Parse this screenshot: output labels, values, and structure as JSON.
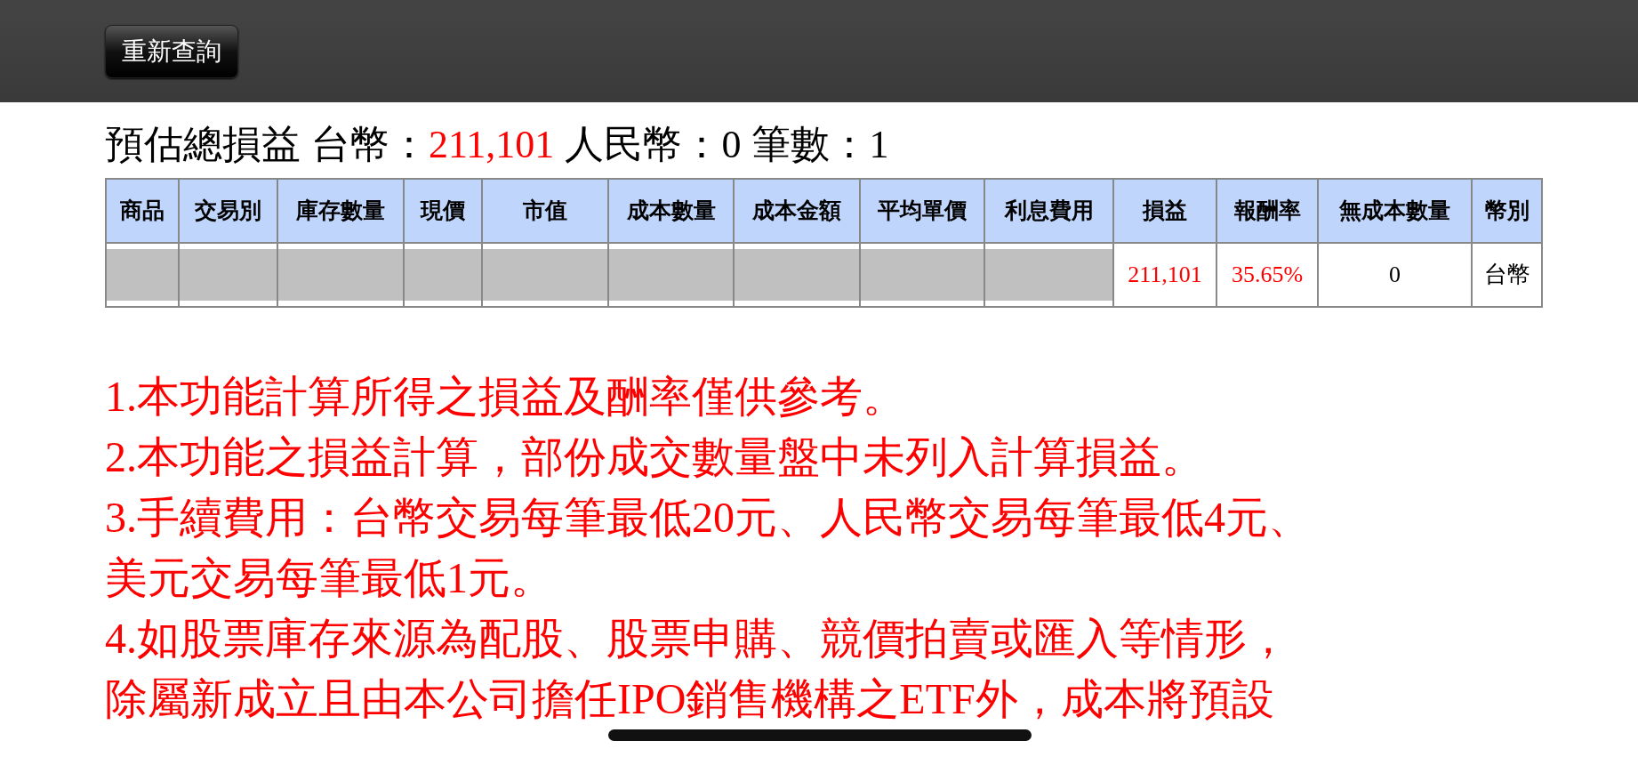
{
  "toolbar": {
    "requery_button": "重新查詢"
  },
  "summary": {
    "title": "預估總損益",
    "items": [
      {
        "label": "台幣：",
        "value": "211,101",
        "highlight": true
      },
      {
        "label": "人民幣：",
        "value": "0",
        "highlight": false
      },
      {
        "label": "筆數：",
        "value": "1",
        "highlight": false
      }
    ]
  },
  "table": {
    "columns": [
      "商品",
      "交易別",
      "庫存數量",
      "現價",
      "市值",
      "成本數量",
      "成本金額",
      "平均單價",
      "利息費用",
      "損益",
      "報酬率",
      "無成本數量",
      "幣別"
    ],
    "rows": [
      {
        "cells": [
          {
            "text": "",
            "redacted": true
          },
          {
            "text": "",
            "redacted": true
          },
          {
            "text": "",
            "redacted": true
          },
          {
            "text": "",
            "redacted": true
          },
          {
            "text": "",
            "redacted": true
          },
          {
            "text": "",
            "redacted": true
          },
          {
            "text": "",
            "redacted": true
          },
          {
            "text": "",
            "redacted": true
          },
          {
            "text": "",
            "redacted": true
          },
          {
            "text": "211,101",
            "highlight": true
          },
          {
            "text": "35.65%",
            "highlight": true
          },
          {
            "text": "0",
            "highlight": false
          },
          {
            "text": "台幣",
            "highlight": false
          }
        ]
      }
    ]
  },
  "notes": [
    "1.本功能計算所得之損益及酬率僅供參考。",
    "2.本功能之損益計算，部份成交數量盤中未列入計算損益。",
    "3.手續費用：台幣交易每筆最低20元、人民幣交易每筆最低4元、美元交易每筆最低1元。",
    "4.如股票庫存來源為配股、股票申購、競價拍賣或匯入等情形，除屬新成立且由本公司擔任IPO銷售機構之ETF外，成本將預設"
  ]
}
